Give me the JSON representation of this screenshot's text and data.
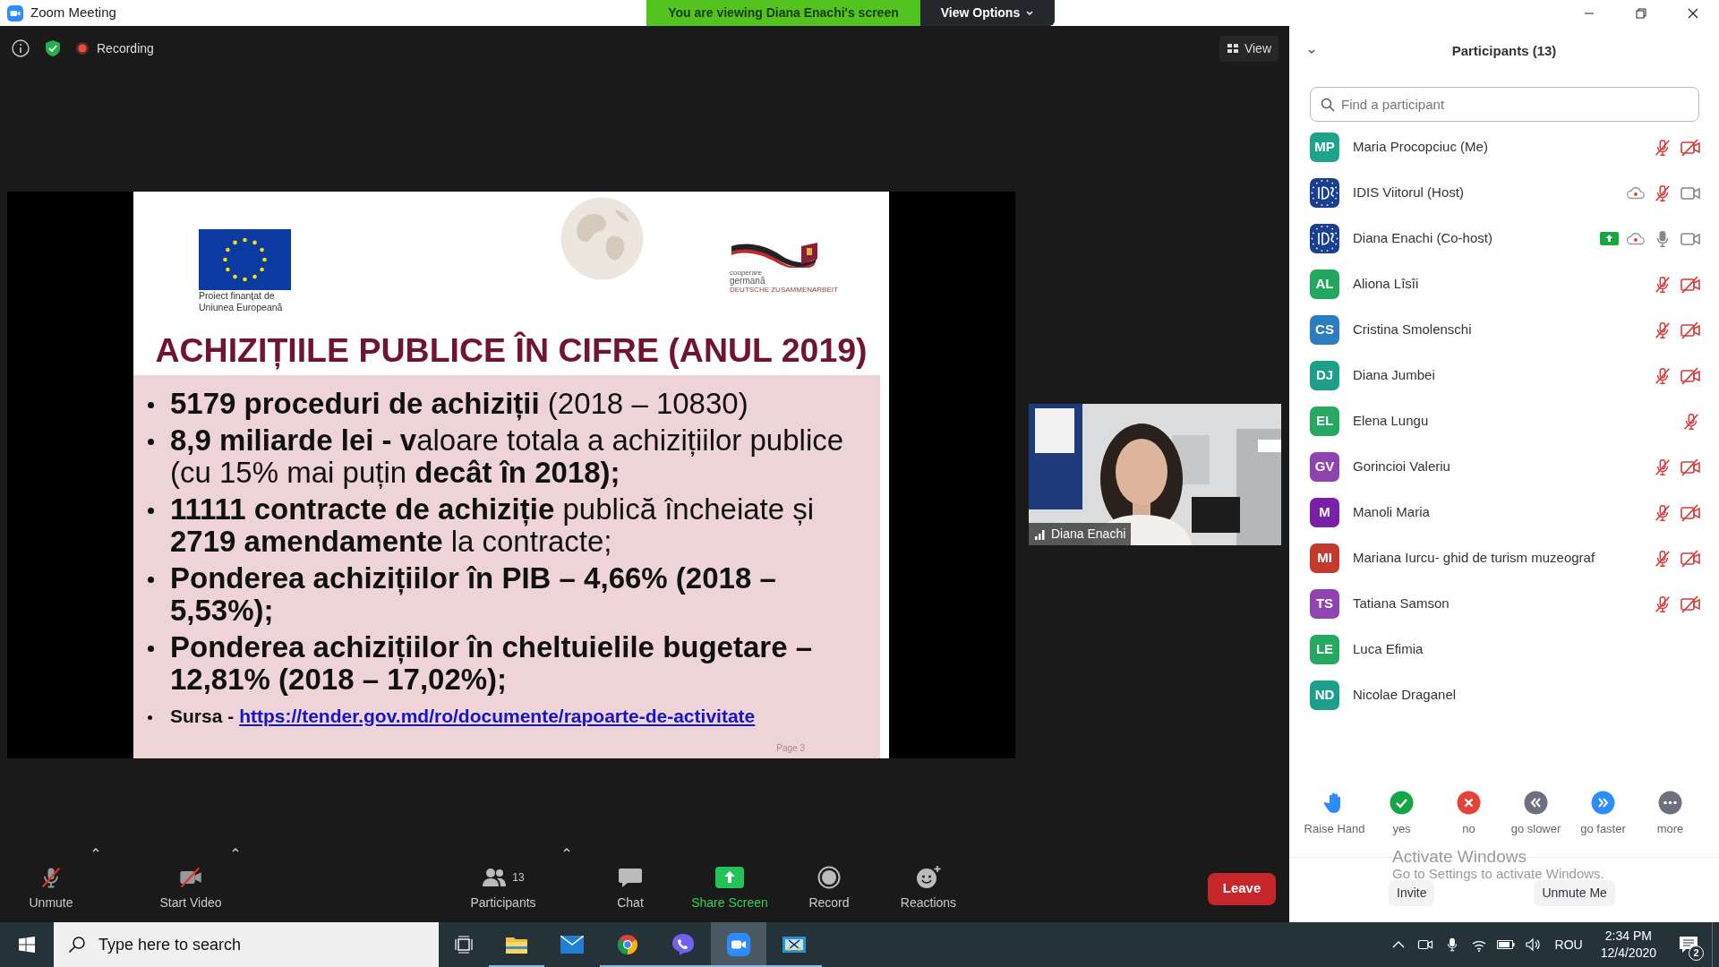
{
  "window": {
    "title": "Zoom Meeting"
  },
  "banner": {
    "text": "You are viewing Diana Enachi's screen",
    "menu": "View Options"
  },
  "meeting_bar": {
    "recording": "Recording",
    "view": "View"
  },
  "slide": {
    "eu_caption": [
      "Proiect finanțat de",
      "Uniunea Europeană"
    ],
    "partner_logo": [
      "cooperare",
      "germană",
      "DEUTSCHE ZUSAMMENARBEIT"
    ],
    "title": "ACHIZIȚIILE PUBLICE ÎN CIFRE (ANUL 2019)",
    "bullets": [
      {
        "text": "**5179 proceduri de achiziții** (2018 – 10830)",
        "bold": false
      },
      {
        "text": "**8,9 miliarde lei - v**aloare totala a achizițiilor publice (cu 15% mai puțin **decât în 2018);**",
        "bold": false
      },
      {
        "text": "**11111 contracte de achiziție** publică încheiate și **2719 amendamente** la contracte;",
        "bold": false
      },
      {
        "text": "Ponderea achizițiilor în PIB – 4,66% (2018 – 5,53%);",
        "bold": true
      },
      {
        "text": "Ponderea achizițiilor în cheltuielile bugetare – 12,81% (2018 – 17,02%);",
        "bold": true
      }
    ],
    "source": {
      "label": "Sursa -",
      "link": "https://tender.gov.md/ro/documente/rapoarte-de-activitate"
    },
    "page": "Page 3"
  },
  "video_tile": {
    "name": "Diana Enachi"
  },
  "toolbar": {
    "left": [
      {
        "kind": "audio",
        "label": "Unmute",
        "muted": true,
        "menu": true
      },
      {
        "kind": "video",
        "label": "Start Video",
        "stopped": true,
        "menu": true
      }
    ],
    "center": [
      {
        "kind": "participants",
        "label": "Participants",
        "count": "13",
        "menu": true
      },
      {
        "kind": "chat",
        "label": "Chat"
      },
      {
        "kind": "share",
        "label": "Share Screen"
      },
      {
        "kind": "record",
        "label": "Record"
      },
      {
        "kind": "reactions",
        "label": "Reactions"
      }
    ],
    "leave": "Leave"
  },
  "participants_panel": {
    "title": "Participants (13)",
    "search": {
      "placeholder": "Find a participant"
    },
    "participants": [
      {
        "kind": "initials",
        "initials": "MP",
        "color": "#1fa389",
        "name": "Maria Procopciuc (Me)",
        "sharing": false,
        "recording": false,
        "muted": true,
        "video_off": true
      },
      {
        "kind": "logo",
        "name": "IDIS Viitorul (Host)",
        "sharing": false,
        "recording": true,
        "muted": true,
        "video_off": false
      },
      {
        "kind": "logo",
        "name": "Diana Enachi (Co-host)",
        "sharing": true,
        "recording": true,
        "muted": false,
        "video_off": false
      },
      {
        "kind": "initials",
        "initials": "AL",
        "color": "#23a65e",
        "name": "Aliona Lîsîi",
        "sharing": false,
        "recording": false,
        "muted": true,
        "video_off": true
      },
      {
        "kind": "initials",
        "initials": "CS",
        "color": "#2b7dbf",
        "name": "Cristina Smolenschi",
        "sharing": false,
        "recording": false,
        "muted": true,
        "video_off": true
      },
      {
        "kind": "initials",
        "initials": "DJ",
        "color": "#1e9f8c",
        "name": "Diana Jumbei",
        "sharing": false,
        "recording": false,
        "muted": true,
        "video_off": true
      },
      {
        "kind": "initials",
        "initials": "EL",
        "color": "#25a861",
        "name": "Elena Lungu",
        "sharing": false,
        "recording": false,
        "muted": true
      },
      {
        "kind": "initials",
        "initials": "GV",
        "color": "#8e44b0",
        "name": "Gorincioi Valeriu",
        "sharing": false,
        "recording": false,
        "muted": true,
        "video_off": true
      },
      {
        "kind": "initials",
        "initials": "M",
        "color": "#7a20a6",
        "name": "Manoli Maria",
        "sharing": false,
        "recording": false,
        "muted": true,
        "video_off": true
      },
      {
        "kind": "initials",
        "initials": "MI",
        "color": "#c23a2e",
        "name": "Mariana Iurcu- ghid de turism muzeograf",
        "sharing": false,
        "recording": false,
        "muted": true,
        "video_off": true
      },
      {
        "kind": "initials",
        "initials": "TS",
        "color": "#9044b2",
        "name": "Tatiana Samson",
        "sharing": false,
        "recording": false,
        "muted": true,
        "video_off": true
      },
      {
        "kind": "initials",
        "initials": "LE",
        "color": "#25a861",
        "name": "Luca Efimia",
        "sharing": false,
        "recording": false
      },
      {
        "kind": "initials",
        "initials": "ND",
        "color": "#1e9f8c",
        "name": "Nicolae Draganel",
        "sharing": false,
        "recording": false
      }
    ],
    "reactions": [
      {
        "kind": "hand",
        "label": "Raise Hand"
      },
      {
        "kind": "yes",
        "label": "yes"
      },
      {
        "kind": "no",
        "label": "no"
      },
      {
        "kind": "slower",
        "label": "go slower"
      },
      {
        "kind": "faster",
        "label": "go faster"
      },
      {
        "kind": "more",
        "label": "more"
      }
    ],
    "buttons": [
      "Invite",
      "Unmute Me"
    ]
  },
  "activation_notice": {
    "title": "Activate Windows",
    "subtitle": "Go to Settings to activate Windows."
  },
  "taskbar": {
    "search": {
      "placeholder": "Type here to search"
    },
    "apps": [
      {
        "kind": "files",
        "running": true,
        "active": false
      },
      {
        "kind": "mail",
        "running": false,
        "active": false
      },
      {
        "kind": "browser",
        "running": true,
        "active": false
      },
      {
        "kind": "messenger",
        "running": true,
        "active": false
      },
      {
        "kind": "meeting",
        "running": true,
        "active": true
      },
      {
        "kind": "snip",
        "running": true,
        "active": false
      }
    ],
    "language": "ROU",
    "time": "2:34 PM",
    "date": "12/4/2020",
    "notifications": "2"
  }
}
